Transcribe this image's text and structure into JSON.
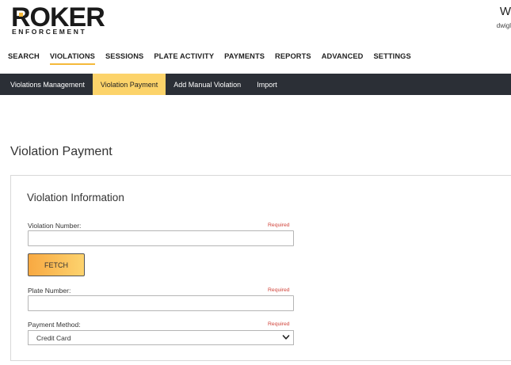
{
  "brand": {
    "name": "ROKER",
    "tagline": "ENFORCEMENT",
    "accent": "#f5b93a"
  },
  "user": {
    "initial": "W",
    "name_partial": "dwigl"
  },
  "main_nav": {
    "items": [
      {
        "label": "SEARCH"
      },
      {
        "label": "VIOLATIONS",
        "active": true
      },
      {
        "label": "SESSIONS"
      },
      {
        "label": "PLATE ACTIVITY"
      },
      {
        "label": "PAYMENTS"
      },
      {
        "label": "REPORTS"
      },
      {
        "label": "ADVANCED"
      },
      {
        "label": "SETTINGS"
      }
    ]
  },
  "sub_nav": {
    "items": [
      {
        "label": "Violations Management"
      },
      {
        "label": "Violation Payment",
        "active": true
      },
      {
        "label": "Add Manual Violation"
      },
      {
        "label": "Import"
      }
    ]
  },
  "page": {
    "title": "Violation Payment"
  },
  "panel": {
    "title": "Violation Information",
    "violation_number": {
      "label": "Violation Number:",
      "required": "Required",
      "value": ""
    },
    "fetch_button": "FETCH",
    "plate_number": {
      "label": "Plate Number:",
      "required": "Required",
      "value": ""
    },
    "payment_method": {
      "label": "Payment Method:",
      "required": "Required",
      "selected": "Credit Card"
    }
  }
}
